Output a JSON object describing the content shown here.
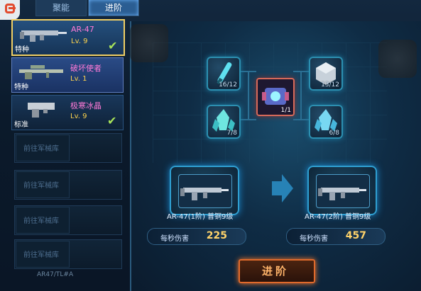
{
  "tabs": [
    {
      "label": "聚能"
    },
    {
      "label": "进阶"
    }
  ],
  "weapons": [
    {
      "name": "AR-47",
      "level": "Lv. 9",
      "tag": "特种",
      "checked": true
    },
    {
      "name": "破坏使者",
      "level": "Lv. 1",
      "tag": "特种",
      "checked": false
    },
    {
      "name": "极寒冰晶",
      "level": "Lv. 9",
      "tag": "标准",
      "checked": true
    }
  ],
  "empty_slots": [
    {
      "label": "前往军械库"
    },
    {
      "label": "前往军械库"
    },
    {
      "label": "前往军械库"
    },
    {
      "label": "前往军械库"
    }
  ],
  "bottom_partial_text": "AR47/TL#A",
  "materials": {
    "left_top": "16/12",
    "left_bottom": "7/8",
    "core": "1/1",
    "right_top": "13/12",
    "right_bottom": "6/8"
  },
  "upgrade": {
    "from_label": "AR-47(1阶) 普铜9级",
    "to_label": "AR-47(2阶) 普铜9级",
    "dps_label": "每秒伤害",
    "from_dps": "225",
    "to_dps": "457",
    "button_label": "进阶"
  },
  "colors": {
    "accent": "#f2d064",
    "dps_value": "#ffd36a",
    "weapon_name": "#ff7ad8",
    "button_border": "#e06a2c"
  }
}
